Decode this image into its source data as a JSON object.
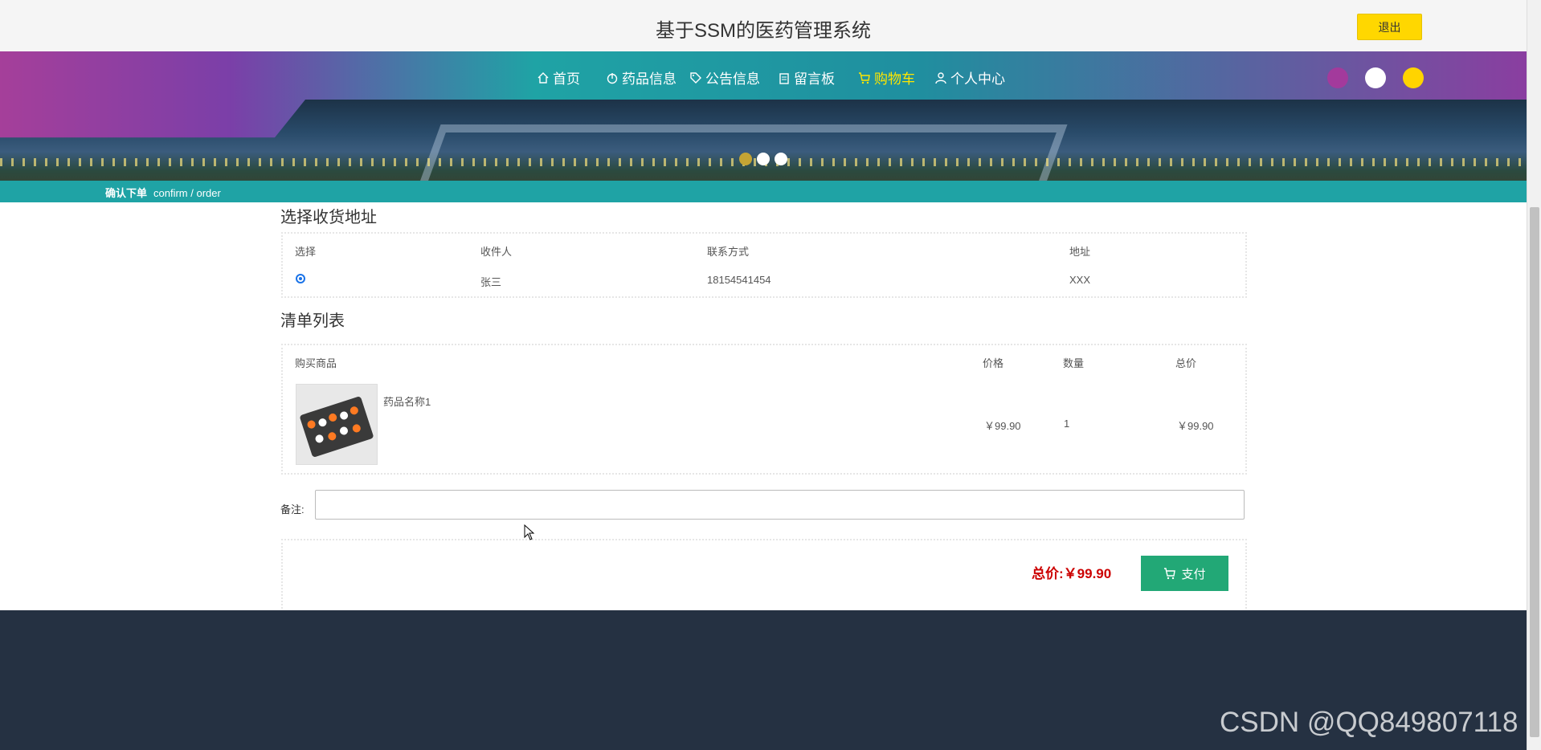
{
  "header": {
    "title": "基于SSM的医药管理系统",
    "logout_label": "退出"
  },
  "nav": {
    "items": [
      {
        "label": "首页",
        "icon": "home-icon"
      },
      {
        "label": "药品信息",
        "icon": "power-icon"
      },
      {
        "label": "公告信息",
        "icon": "tag-icon"
      },
      {
        "label": "留言板",
        "icon": "clipboard-icon"
      },
      {
        "label": "购物车",
        "icon": "cart-icon",
        "active": true
      },
      {
        "label": "个人中心",
        "icon": "user-icon"
      }
    ],
    "active_color": "#ffe600"
  },
  "theme_colors": [
    "#a33a9c",
    "#ffffff",
    "#ffd400"
  ],
  "carousel": {
    "active_index": 0,
    "dot_colors": [
      "#c4a434",
      "#ffffff",
      "#ffffff"
    ]
  },
  "breadcrumb": {
    "cn": "确认下单",
    "en": "confirm / order"
  },
  "address": {
    "title": "选择收货地址",
    "headers": [
      "选择",
      "收件人",
      "联系方式",
      "地址"
    ],
    "rows": [
      {
        "selected": true,
        "name": "张三",
        "phone": "18154541454",
        "address": "XXX"
      }
    ]
  },
  "order": {
    "title": "清单列表",
    "headers": [
      "购买商品",
      "价格",
      "数量",
      "总价"
    ],
    "items": [
      {
        "name": "药品名称1",
        "price": "￥99.90",
        "qty": "1",
        "subtotal": "￥99.90"
      }
    ]
  },
  "remark": {
    "label": "备注:",
    "value": ""
  },
  "summary": {
    "total_label": "总价:",
    "total_value": "￥99.90",
    "pay_label": "支付"
  },
  "watermark": "CSDN @QQ849807118",
  "colors": {
    "teal": "#1fa3a5",
    "purple": "#a53f9a",
    "pay": "#22a876",
    "footer": "#253142",
    "price_red": "#cc0000"
  }
}
